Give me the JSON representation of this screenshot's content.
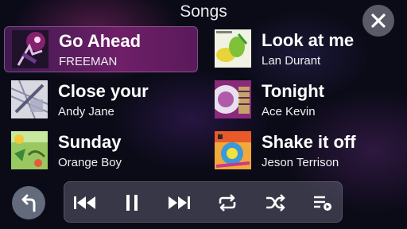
{
  "header": {
    "title": "Songs"
  },
  "icons": {
    "close": "close-icon",
    "back": "up-arrow-icon",
    "previous": "skip-previous-icon",
    "pause": "pause-icon",
    "next": "skip-next-icon",
    "repeat": "repeat-icon",
    "shuffle": "shuffle-icon",
    "queue": "queue-list-icon"
  },
  "songs": [
    {
      "title": "Go Ahead",
      "artist": "FREEMAN",
      "active": true
    },
    {
      "title": "Look at me",
      "artist": "Lan Durant",
      "active": false
    },
    {
      "title": "Close your",
      "artist": "Andy Jane",
      "active": false
    },
    {
      "title": "Tonight",
      "artist": "Ace Kevin",
      "active": false
    },
    {
      "title": "Sunday",
      "artist": "Orange Boy",
      "active": false
    },
    {
      "title": "Shake it off",
      "artist": "Jeson Terrison",
      "active": false
    }
  ],
  "colors": {
    "active_row": "#6e1f68",
    "background": "#0b0b18"
  }
}
